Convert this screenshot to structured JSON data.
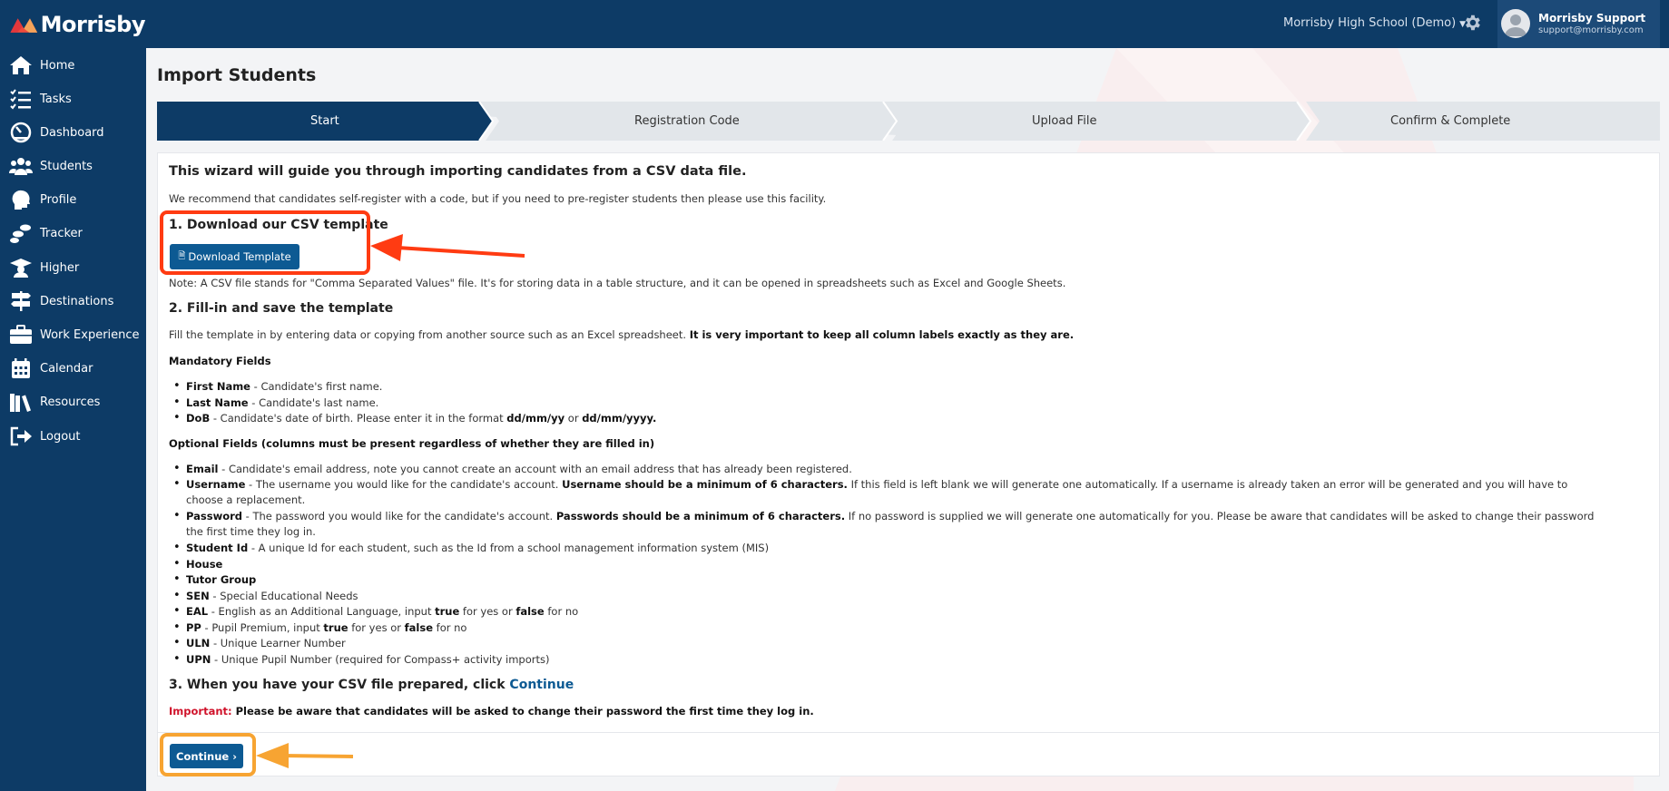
{
  "app": {
    "logo_text": "Morrisby",
    "school": "Morrisby High School (Demo)",
    "user_name": "Morrisby Support",
    "user_email": "support@morrisby.com"
  },
  "sidebar": {
    "items": [
      {
        "label": "Home",
        "icon": "home-icon"
      },
      {
        "label": "Tasks",
        "icon": "tasks-icon"
      },
      {
        "label": "Dashboard",
        "icon": "dashboard-icon"
      },
      {
        "label": "Students",
        "icon": "students-icon"
      },
      {
        "label": "Profile",
        "icon": "profile-icon"
      },
      {
        "label": "Tracker",
        "icon": "tracker-icon"
      },
      {
        "label": "Higher",
        "icon": "graduation-cap-icon"
      },
      {
        "label": "Destinations",
        "icon": "signpost-icon"
      },
      {
        "label": "Work Experience",
        "icon": "briefcase-icon"
      },
      {
        "label": "Calendar",
        "icon": "calendar-icon"
      },
      {
        "label": "Resources",
        "icon": "books-icon"
      },
      {
        "label": "Logout",
        "icon": "logout-icon"
      }
    ]
  },
  "page": {
    "title": "Import Students",
    "steps": [
      "Start",
      "Registration Code",
      "Upload File",
      "Confirm & Complete"
    ]
  },
  "content": {
    "intro_heading": "This wizard will guide you through importing candidates from a CSV data file.",
    "intro_text": "We recommend that candidates self-register with a code, but if you need to pre-register students then please use this facility.",
    "step1_heading": "1. Download our CSV template",
    "download_button": "Download Template",
    "note": "Note: A CSV file stands for \"Comma Separated Values\" file. It's for storing data in a table structure, and it can be opened in spreadsheets such as Excel and Google Sheets.",
    "step2_heading": "2. Fill-in and save the template",
    "fill_text": "Fill the template in by entering data or copying from another source such as an Excel spreadsheet.",
    "fill_text_bold": "It is very important to keep all column labels exactly as they are.",
    "mandatory_heading": "Mandatory Fields",
    "mandatory": [
      {
        "name": "First Name",
        "desc": " - Candidate's first name."
      },
      {
        "name": "Last Name",
        "desc": " - Candidate's last name."
      },
      {
        "name": "DoB",
        "desc": " - Candidate's date of birth. Please enter it in the format ",
        "b1": "dd/mm/yy",
        "mid": " or ",
        "b2": "dd/mm/yyyy."
      }
    ],
    "optional_heading": "Optional Fields (columns must be present regardless of whether they are filled in)",
    "optional": {
      "email": {
        "name": "Email",
        "desc": " - Candidate's email address, note you cannot create an account with an email address that has already been registered."
      },
      "username": {
        "name": "Username",
        "desc": " - The username you would like for the candidate's account. ",
        "bold": "Username should be a minimum of 6 characters.",
        "rest": " If this field is left blank we will generate one automatically. If a username is already taken an error will be generated and you will have to choose a replacement."
      },
      "password": {
        "name": "Password",
        "desc": " - The password you would like for the candidate's account. ",
        "bold": "Passwords should be a minimum of 6 characters.",
        "rest": " If no password is supplied we will generate one automatically for you. Please be aware that candidates will be asked to change their password the first time they log in."
      },
      "student_id": {
        "name": "Student Id",
        "desc": " - A unique Id for each student, such as the Id from a school management information system (MIS)"
      },
      "house": {
        "name": "House"
      },
      "tutor": {
        "name": "Tutor Group"
      },
      "sen": {
        "name": "SEN",
        "desc": " - Special Educational Needs"
      },
      "eal": {
        "name": "EAL",
        "desc": " - English as an Additional Language, input ",
        "t": "true",
        "m": " for yes or ",
        "f": "false",
        "e": " for no"
      },
      "pp": {
        "name": "PP",
        "desc": " - Pupil Premium, input ",
        "t": "true",
        "m": " for yes or ",
        "f": "false",
        "e": " for no"
      },
      "uln": {
        "name": "ULN",
        "desc": " - Unique Learner Number"
      },
      "upn": {
        "name": "UPN",
        "desc": " - Unique Pupil Number (required for Compass+ activity imports)"
      }
    },
    "step3_heading": "3. When you have your CSV file prepared, click ",
    "step3_link": "Continue",
    "important_label": "Important:",
    "important_text": " Please be aware that candidates will be asked to change their password the first time they log in.",
    "continue_button": "Continue"
  }
}
